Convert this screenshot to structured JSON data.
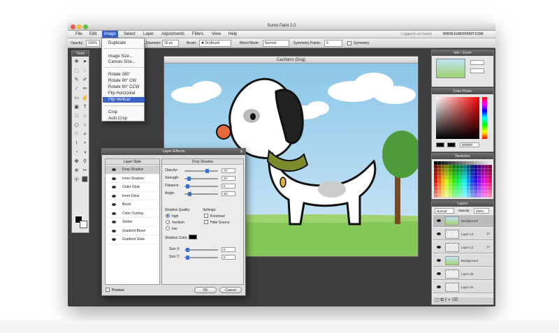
{
  "window": {
    "title": "Sumo Paint 2.0"
  },
  "menu": [
    "File",
    "Edit",
    "Image",
    "Select",
    "Layer",
    "Adjustments",
    "Filters",
    "View",
    "Help"
  ],
  "menu_right": "Logged in as Guest",
  "logo": "WWW.SUMOPAINT.COM",
  "options": {
    "opacity_label": "Opacity:",
    "opacity": "100%",
    "diameter_label": "Diameter:",
    "diameter": "30 px",
    "brush_label": "Brush:",
    "brush": "DryBrush",
    "blend_label": "Blend Mode:",
    "blend": "Normal",
    "symmetry_label": "Symmetry Points:",
    "symmetry": "6",
    "symmetry_check": "Symmetry"
  },
  "image_menu": {
    "items": [
      "Duplicate",
      "Image Size...",
      "Canvas Size...",
      "Rotate 180°",
      "Rotate 90° CW",
      "Rotate 90° CCW",
      "Flip Horizontal",
      "Flip Vertical",
      "Crop",
      "Auto Crop"
    ],
    "selected": "Flip Vertical"
  },
  "tools_title": "Tools",
  "canvas": {
    "title": "Cachorro (Dog)"
  },
  "dialog": {
    "title": "Layer Effects",
    "list_header": "Layer Style",
    "styles": [
      "Drop Shadow",
      "Inner Shadow",
      "Outer Glow",
      "Inner Glow",
      "Bevel",
      "Color Overlay",
      "Stroke",
      "Gradient Bevel",
      "Gradient Glow"
    ],
    "selected_style": "Drop Shadow",
    "section_header": "Drop Shadow",
    "params": [
      {
        "label": "Opacity:",
        "value": "70"
      },
      {
        "label": "Strength:",
        "value": "10"
      },
      {
        "label": "Distance:",
        "value": "5"
      },
      {
        "label": "Angle:",
        "value": "45"
      }
    ],
    "quality_label": "Shadow Quality:",
    "quality": [
      "high",
      "medium",
      "low"
    ],
    "quality_selected": "high",
    "settings_label": "Settings:",
    "settings": [
      "Knockout",
      "Hide Source"
    ],
    "shadow_color_label": "Shadow Color:",
    "shadow_color": "#000000",
    "size": [
      {
        "label": "Size X:",
        "value": "5"
      },
      {
        "label": "Size Y:",
        "value": "5"
      }
    ],
    "preview": "Preview",
    "ok": "OK",
    "cancel": "Cancel"
  },
  "info_panel": {
    "title": "Info / Zoom"
  },
  "color_picker": {
    "title": "Color Picker",
    "hex": "000000"
  },
  "swatches": {
    "title": "Swatches"
  },
  "layers": {
    "title": "Layers",
    "blend": "Normal",
    "opacity_label": "Opacity:",
    "opacity": "100%",
    "rows": [
      "Background",
      "Layer 13",
      "Layer 12",
      "Background",
      "Layer 25",
      "Layer 24"
    ]
  }
}
